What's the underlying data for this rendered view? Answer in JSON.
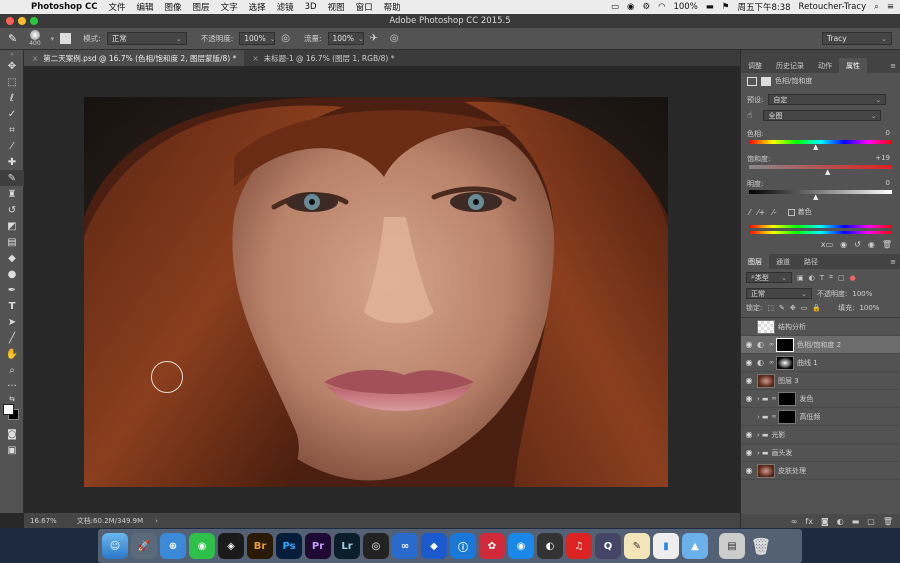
{
  "menubar": {
    "app": "Photoshop CC",
    "items": [
      "文件",
      "编辑",
      "图像",
      "图层",
      "文字",
      "选择",
      "滤镜",
      "3D",
      "视图",
      "窗口",
      "帮助"
    ],
    "battery": "100%",
    "clock": "周五下午8:38",
    "user": "Retoucher-Tracy"
  },
  "window": {
    "title": "Adobe Photoshop CC 2015.5"
  },
  "options": {
    "brush_size": "400",
    "mode_label": "模式:",
    "mode_value": "正常",
    "opacity_label": "不透明度:",
    "opacity_value": "100%",
    "flow_label": "流量:",
    "flow_value": "100%",
    "workspace": "Tracy"
  },
  "tabs": [
    {
      "label": "第二天案例.psd @ 16.7% (色相/饱和度 2, 图层蒙版/8) *"
    },
    {
      "label": "未标题-1 @ 16.7% (图层 1, RGB/8) *"
    }
  ],
  "status": {
    "zoom": "16.67%",
    "doc": "文档:60.2M/349.9M"
  },
  "properties": {
    "tabs": [
      "调整",
      "历史记录",
      "动作",
      "属性"
    ],
    "header": "色相/饱和度",
    "preset_label": "预设:",
    "preset_value": "自定",
    "channel_value": "全图",
    "hue_label": "色相:",
    "hue_value": "0",
    "saturation_label": "饱和度:",
    "saturation_value": "+19",
    "lightness_label": "明度:",
    "lightness_value": "0",
    "colorize_label": "着色"
  },
  "layers_panel": {
    "tabs": [
      "图层",
      "通道",
      "路径"
    ],
    "filter_value": "类型",
    "blend_value": "正常",
    "opacity_label": "不透明度:",
    "opacity_value": "100%",
    "lock_label": "锁定:",
    "fill_label": "填充:",
    "fill_value": "100%",
    "layers": [
      {
        "name": "结构分析"
      },
      {
        "name": "色相/饱和度 2"
      },
      {
        "name": "曲线 1"
      },
      {
        "name": "图层 3"
      },
      {
        "name": "发色"
      },
      {
        "name": "高低频"
      },
      {
        "name": "光影"
      },
      {
        "name": "画头发"
      },
      {
        "name": "皮肤处理"
      }
    ]
  },
  "dock": {
    "apps": [
      {
        "label": "Br",
        "color": "#2a1a05"
      },
      {
        "label": "Ps",
        "color": "#061e3a"
      },
      {
        "label": "Pr",
        "color": "#1e0a33"
      },
      {
        "label": "Lr",
        "color": "#0c1e2a"
      }
    ]
  }
}
